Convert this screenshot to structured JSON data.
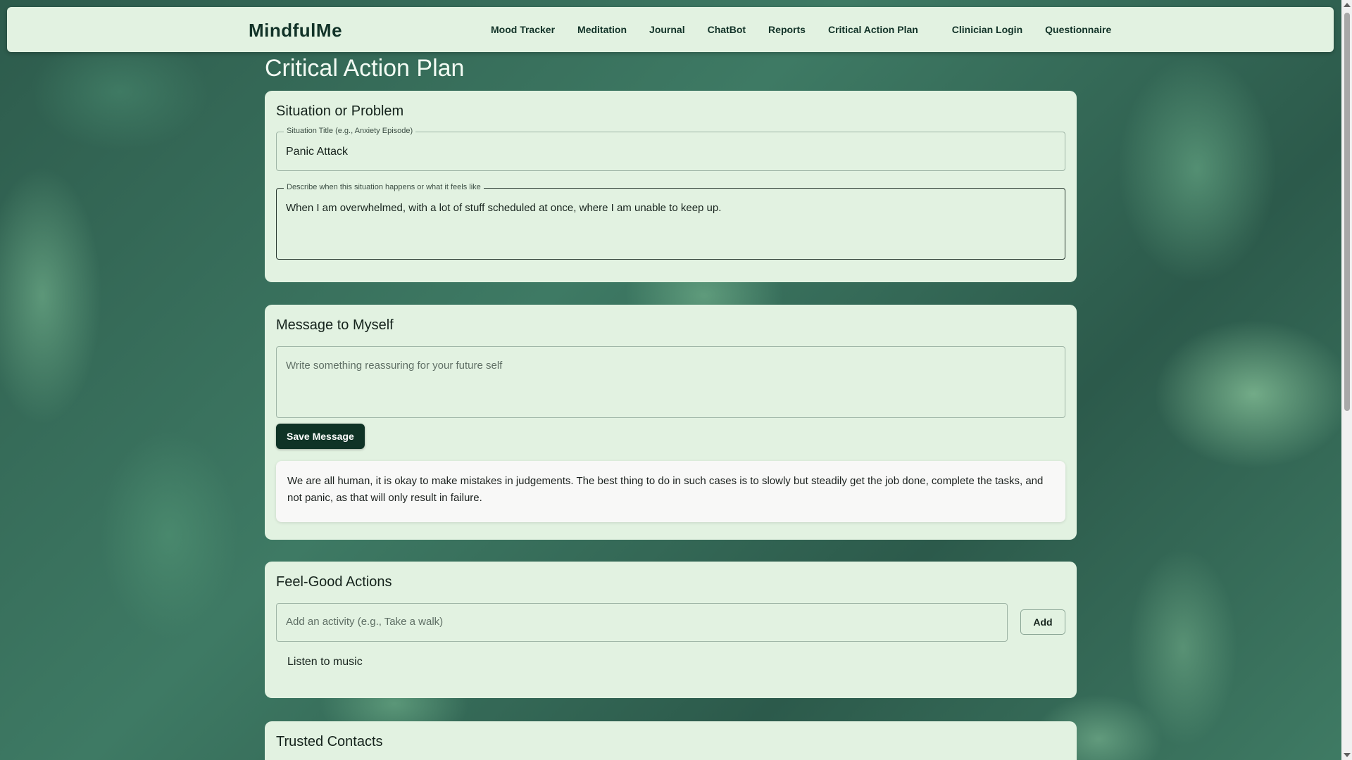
{
  "nav": {
    "brand": "MindfulMe",
    "links": [
      "Mood Tracker",
      "Meditation",
      "Journal",
      "ChatBot",
      "Reports",
      "Critical Action Plan",
      "Clinician Login",
      "Questionnaire"
    ]
  },
  "page": {
    "title": "Critical Action Plan"
  },
  "situation": {
    "heading": "Situation or Problem",
    "title_label": "Situation Title (e.g., Anxiety Episode)",
    "title_value": "Panic Attack",
    "desc_label": "Describe when this situation happens or what it feels like",
    "desc_value": "When I am overwhelmed, with a lot of stuff scheduled at once, where I am unable to keep up."
  },
  "message": {
    "heading": "Message to Myself",
    "placeholder": "Write something reassuring for your future self",
    "save_label": "Save Message",
    "saved_text": "We are all human, it is okay to make mistakes in judgements. The best thing to do in such cases is to slowly but steadily get the job done, complete the tasks, and not panic, as that will only result in failure."
  },
  "actions": {
    "heading": "Feel-Good Actions",
    "placeholder": "Add an activity (e.g., Take a walk)",
    "add_label": "Add",
    "items": [
      "Listen to music"
    ]
  },
  "contacts": {
    "heading": "Trusted Contacts"
  },
  "colors": {
    "brand_dark": "#0f3326",
    "card_bg": "#e2f2e1",
    "page_bg": "#2f5f4f"
  }
}
